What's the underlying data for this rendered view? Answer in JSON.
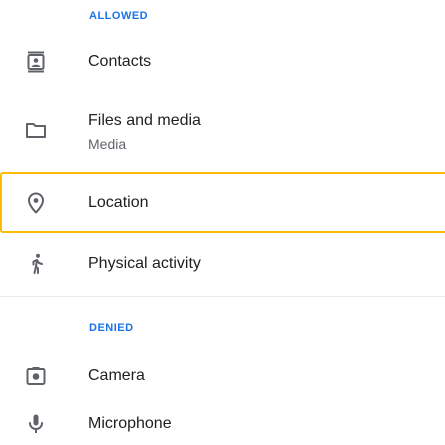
{
  "sections": {
    "allowed_header": "ALLOWED",
    "denied_header": "DENIED"
  },
  "permissions": {
    "contacts": {
      "label": "Contacts",
      "icon": "contacts-icon"
    },
    "files": {
      "label": "Files and media",
      "sublabel": "Media",
      "icon": "folder-icon"
    },
    "location": {
      "label": "Location",
      "icon": "location-pin-icon"
    },
    "activity": {
      "label": "Physical activity",
      "icon": "running-person-icon"
    },
    "camera": {
      "label": "Camera",
      "icon": "camera-icon"
    },
    "microphone": {
      "label": "Microphone",
      "icon": "microphone-icon"
    }
  },
  "colors": {
    "accent": "#1a73e8",
    "highlight": "#fbbc04",
    "text_primary": "#202124",
    "text_secondary": "#5f6368",
    "icon": "#5f6368"
  }
}
